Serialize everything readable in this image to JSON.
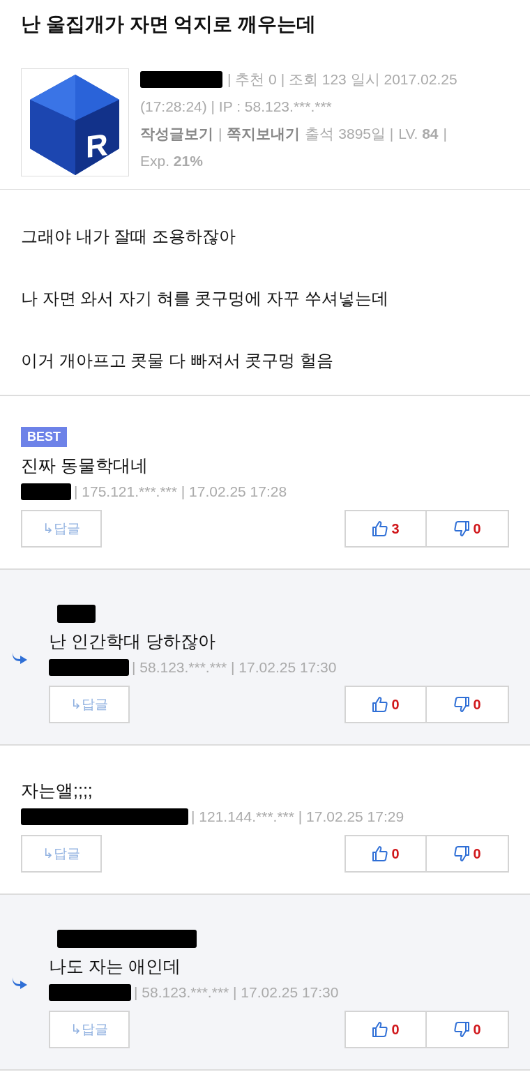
{
  "post": {
    "title": "난 울집개가 자면 억지로 깨우는데",
    "avatar_letter": "R",
    "meta": "| 추천 0 | 조회 123 일시 2017.02.25",
    "meta_2": "(17:28:24) | IP : 58.123.***.***",
    "links": [
      "작성글보기",
      "쪽지보내기"
    ],
    "separator": "|",
    "attendance": "출석 3895일 |",
    "level": "LV. **84**",
    "exp": "Exp. **21%**",
    "paragraphs": [
      "그래야 내가 잘때 조용하잖아",
      "나 자면 와서 자기 혀를 콧구멍에 자꾸 쑤셔넣는데",
      "이거 개아프고 콧물 다 빠져서 콧구멍 헐음"
    ]
  },
  "comments": [
    {
      "kind": "comment",
      "badge": "BEST",
      "text": "진짜 동물학대네",
      "meta": "| 175.121.***.*** | 17.02.25 17:28",
      "reply_button": "↳답글",
      "likes": "3",
      "dislikes": "0"
    },
    {
      "kind": "reply",
      "text": "난 인간학대 당하잖아",
      "meta": "| 58.123.***.*** | 17.02.25 17:30",
      "reply_button": "↳답글",
      "likes": "0",
      "dislikes": "0"
    },
    {
      "kind": "comment",
      "text": "자는앨;;;;",
      "meta": "| 121.144.***.*** | 17.02.25 17:29",
      "reply_button": "↳답글",
      "likes": "0",
      "dislikes": "0"
    },
    {
      "kind": "reply",
      "text": "나도 자는 애인데",
      "meta": "| 58.123.***.*** | 17.02.25 17:30",
      "reply_button": "↳답글",
      "likes": "0",
      "dislikes": "0"
    }
  ]
}
